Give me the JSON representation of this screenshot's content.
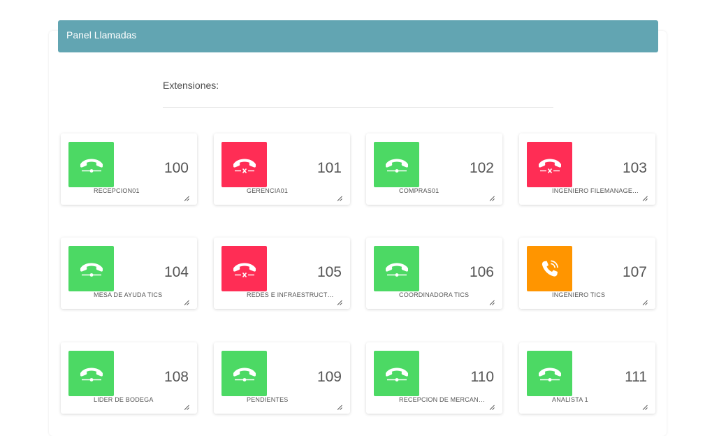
{
  "panel": {
    "title": "Panel Llamadas",
    "extensions_label": "Extensiones:"
  },
  "colors": {
    "idle": "#4cd964",
    "unavailable": "#ff2d55",
    "ringing": "#ff9500",
    "header": "#62a5b2"
  },
  "extensions": [
    {
      "number": "100",
      "name": "RECEPCION01",
      "status": "idle",
      "icon": "phone-hangup-icon"
    },
    {
      "number": "101",
      "name": "GERENCIA01",
      "status": "unavailable",
      "icon": "phone-hangup-x-icon"
    },
    {
      "number": "102",
      "name": "COMPRAS01",
      "status": "idle",
      "icon": "phone-hangup-icon"
    },
    {
      "number": "103",
      "name": "INGENIERO FILEMANAGER I...",
      "status": "unavailable",
      "icon": "phone-hangup-x-icon"
    },
    {
      "number": "104",
      "name": "MESA DE AYUDA TICS",
      "status": "idle",
      "icon": "phone-hangup-icon"
    },
    {
      "number": "105",
      "name": "REDES E INFRAESTRUCTUR...",
      "status": "unavailable",
      "icon": "phone-hangup-x-icon"
    },
    {
      "number": "106",
      "name": "COORDINADORA TICS",
      "status": "idle",
      "icon": "phone-hangup-icon"
    },
    {
      "number": "107",
      "name": "INGENIERO TICS",
      "status": "ringing",
      "icon": "phone-ringing-icon"
    },
    {
      "number": "108",
      "name": "LIDER DE BODEGA",
      "status": "idle",
      "icon": "phone-hangup-icon"
    },
    {
      "number": "109",
      "name": "PENDIENTES",
      "status": "idle",
      "icon": "phone-hangup-icon"
    },
    {
      "number": "110",
      "name": "RECEPCION DE MERCANCIAS",
      "status": "idle",
      "icon": "phone-hangup-icon"
    },
    {
      "number": "111",
      "name": "ANALISTA 1",
      "status": "idle",
      "icon": "phone-hangup-icon"
    }
  ]
}
